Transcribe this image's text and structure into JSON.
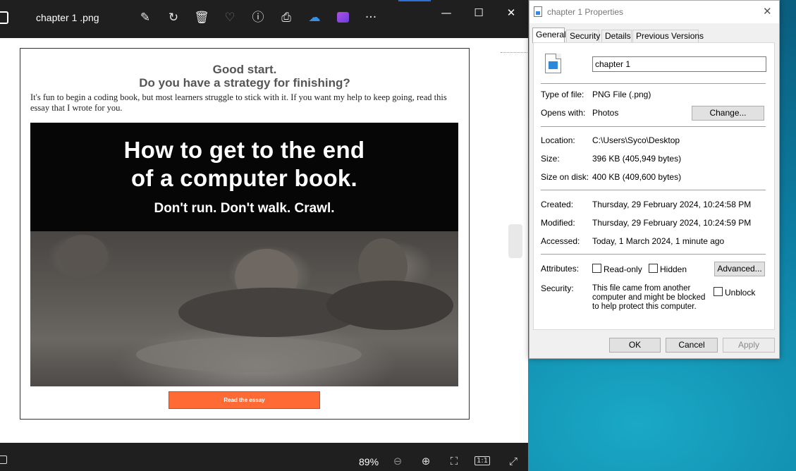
{
  "photos_app": {
    "title": "chapter 1 .png",
    "toolbar_icons": [
      "edit-icon",
      "rotate-icon",
      "delete-icon",
      "favorite-heart-icon",
      "info-icon",
      "print-icon",
      "onedrive-icon",
      "clipchamp-icon",
      "more-icon"
    ],
    "zoom_level": "89%",
    "bottom_icons": [
      "zoom-out-icon",
      "zoom-in-icon",
      "fit-screen-icon",
      "actual-size-icon",
      "fullscreen-icon"
    ],
    "actual_size_label": "1:1"
  },
  "image_content": {
    "heading_line1": "Good start.",
    "heading_line2": "Do you have a strategy for finishing?",
    "body_text": "It's fun to begin a coding book, but most learners struggle to stick with it. If you want my help to keep going, read this essay that I wrote for you.",
    "hero_line1": "How to get to the end",
    "hero_line2": "of a computer book.",
    "hero_line3": "Don't run. Don't walk. Crawl.",
    "cta_label": "Read the essay",
    "cta_color": "#ff6a35"
  },
  "properties_dialog": {
    "title": "chapter 1  Properties",
    "tabs": [
      "General",
      "Security",
      "Details",
      "Previous Versions"
    ],
    "active_tab": "General",
    "file_name": "chapter 1",
    "type_label": "Type of file:",
    "type_value": "PNG File (.png)",
    "opens_label": "Opens with:",
    "opens_value": "Photos",
    "change_button": "Change...",
    "location_label": "Location:",
    "location_value": "C:\\Users\\Syco\\Desktop",
    "size_label": "Size:",
    "size_value": "396 KB (405,949 bytes)",
    "size_disk_label": "Size on disk:",
    "size_disk_value": "400 KB (409,600 bytes)",
    "created_label": "Created:",
    "created_value": "Thursday, 29 February 2024, 10:24:58 PM",
    "modified_label": "Modified:",
    "modified_value": "Thursday, 29 February 2024, 10:24:59 PM",
    "accessed_label": "Accessed:",
    "accessed_value": "Today, 1 March 2024, 1 minute ago",
    "attributes_label": "Attributes:",
    "readonly_label": "Read-only",
    "hidden_label": "Hidden",
    "advanced_button": "Advanced...",
    "security_label": "Security:",
    "security_message": "This file came from another computer and might be blocked to help protect this computer.",
    "unblock_label": "Unblock",
    "ok_button": "OK",
    "cancel_button": "Cancel",
    "apply_button": "Apply"
  }
}
